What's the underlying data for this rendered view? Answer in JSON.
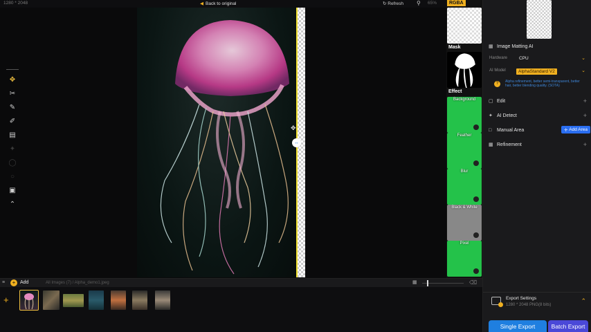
{
  "topbar": {
    "dimensions": "1280 * 2048",
    "back_label": "Back to original",
    "refresh_label": "Refresh",
    "zoom": "65%"
  },
  "tools": [
    "move-tool-icon",
    "eraser-icon",
    "brush-icon",
    "paint-icon",
    "roller-icon",
    "wand-icon",
    "lasso-icon",
    "circle-icon",
    "frame-icon",
    "collapse-icon"
  ],
  "strip": {
    "rgba_label": "RGBA",
    "mask_label": "Mask",
    "effect_label": "Effect",
    "effects": [
      "Background",
      "Feather",
      "Blur",
      "Black & White",
      "Pixel"
    ]
  },
  "panel": {
    "title": "Image Matting AI",
    "hardware_label": "Hardware",
    "hardware_value": "CPU",
    "model_label": "AI Model",
    "model_value": "AlphaStandard  V2",
    "hint": "Alpha refinement, better semi-transparent, better hair, better blending quality. (SOTA)",
    "sections": {
      "edit": "Edit",
      "ai_detect": "AI Detect",
      "manual_area": "Manual Area",
      "refinement": "Refinement"
    },
    "add_area_label": "Add Area"
  },
  "export": {
    "title": "Export Settings",
    "subtitle": "1280 * 2048 PNG(8 bits)",
    "single_label": "Single Export",
    "batch_label": "Batch Export"
  },
  "bottom": {
    "add_label": "Add",
    "path": "All Images (7)  /  Alpha_demo1.jpeg"
  },
  "colors": {
    "accent": "#f0b020",
    "primary_blue": "#1f7fe0",
    "batch_purple": "#4a48d8",
    "effect_green": "#24c24a"
  }
}
